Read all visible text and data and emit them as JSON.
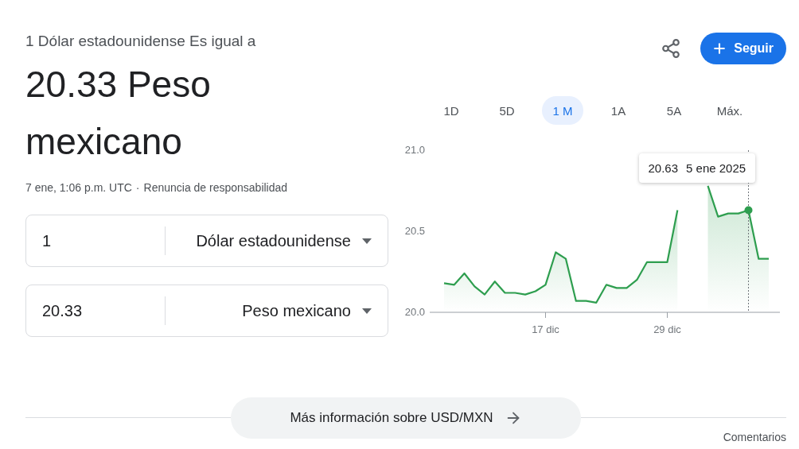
{
  "header": {
    "subtitle": "1 Dólar estadounidense Es igual a",
    "result": "20.33 Peso mexicano",
    "meta": "7 ene, 1:06 p.m. UTC",
    "separator": "·",
    "disclaimer": "Renuncia de responsabilidad"
  },
  "actions": {
    "follow": "Seguir"
  },
  "converter": [
    {
      "amount": "1",
      "currency": "Dólar estadounidense"
    },
    {
      "amount": "20.33",
      "currency": "Peso mexicano"
    }
  ],
  "ranges": [
    {
      "label": "1D",
      "selected": false
    },
    {
      "label": "5D",
      "selected": false
    },
    {
      "label": "1 M",
      "selected": true
    },
    {
      "label": "1A",
      "selected": false
    },
    {
      "label": "5A",
      "selected": false
    },
    {
      "label": "Máx.",
      "selected": false
    }
  ],
  "chart_data": {
    "type": "area",
    "categories": [
      null,
      null,
      null,
      null,
      null,
      null,
      null,
      null,
      null,
      null,
      "17 dic",
      null,
      null,
      null,
      null,
      null,
      null,
      null,
      null,
      null,
      null,
      null,
      "29 dic",
      null,
      null,
      null,
      null,
      null,
      null,
      null,
      null,
      null,
      null
    ],
    "series": [
      {
        "color": "#2e9e4f",
        "values": [
          20.18,
          20.17,
          20.24,
          20.16,
          20.11,
          20.19,
          20.12,
          20.12,
          20.11,
          20.13,
          20.17,
          20.37,
          20.33,
          20.07,
          20.07,
          20.06,
          20.17,
          20.15,
          20.15,
          20.2,
          20.31,
          20.31,
          20.31,
          20.63,
          null,
          null,
          20.78,
          20.59,
          20.61,
          20.61,
          20.63,
          20.33,
          20.33
        ]
      }
    ],
    "ylim": [
      20,
      21
    ],
    "yticks": [
      {
        "value": 20,
        "label": "20.0"
      },
      {
        "value": 20.5,
        "label": "20.5"
      },
      {
        "value": 21,
        "label": "21.0"
      }
    ]
  },
  "tooltip": {
    "value": "20.63",
    "date": "5 ene 2025"
  },
  "more_button": "Más información sobre USD/MXN",
  "feedback": "Comentarios"
}
